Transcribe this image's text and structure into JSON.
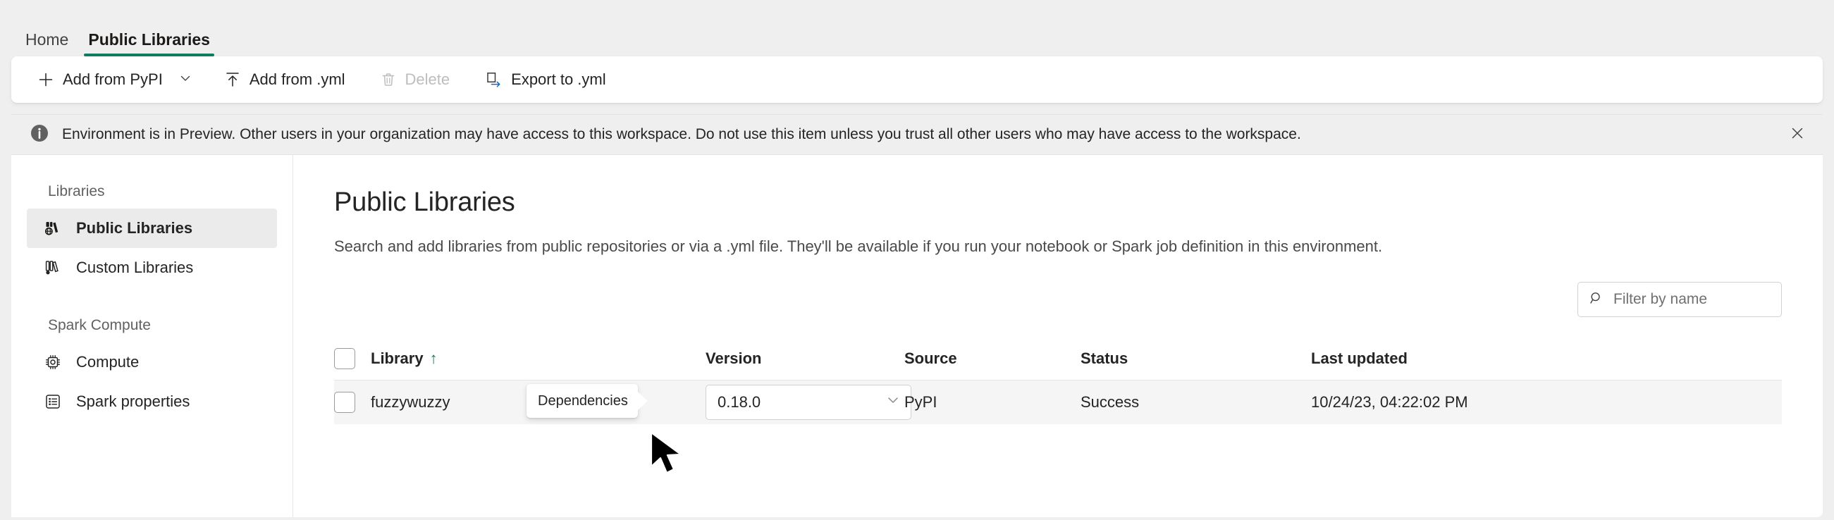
{
  "tabs": [
    {
      "label": "Home",
      "active": false
    },
    {
      "label": "Public Libraries",
      "active": true
    }
  ],
  "toolbar": {
    "add_from_pypi": "Add from PyPI",
    "add_from_yml": "Add from .yml",
    "delete": "Delete",
    "export_to_yml": "Export to .yml",
    "chevron_icon": "chevron-down-icon",
    "plus_icon": "plus-icon",
    "upload_icon": "upload-arrow-icon",
    "trash_icon": "trash-icon",
    "export_icon": "export-page-icon"
  },
  "notification": {
    "icon": "info-icon",
    "message": "Environment is in Preview. Other users in your organization may have access to this workspace. Do not use this item unless you trust all other users who may have access to the workspace.",
    "close_icon": "close-icon"
  },
  "sidebar": {
    "groups": [
      {
        "title": "Libraries",
        "items": [
          {
            "label": "Public Libraries",
            "icon": "public-libraries-icon",
            "selected": true
          },
          {
            "label": "Custom Libraries",
            "icon": "custom-libraries-icon",
            "selected": false
          }
        ]
      },
      {
        "title": "Spark Compute",
        "items": [
          {
            "label": "Compute",
            "icon": "chip-icon",
            "selected": false
          },
          {
            "label": "Spark properties",
            "icon": "list-properties-icon",
            "selected": false
          }
        ]
      }
    ]
  },
  "main": {
    "title": "Public Libraries",
    "description": "Search and add libraries from public repositories or via a .yml file. They'll be available if you run your notebook or Spark job definition in this environment.",
    "filter": {
      "placeholder": "Filter by name",
      "value": "",
      "icon": "search-icon"
    },
    "table": {
      "columns": [
        {
          "key": "library",
          "label": "Library",
          "sort": "ascending",
          "sort_glyph": "↑"
        },
        {
          "key": "version",
          "label": "Version"
        },
        {
          "key": "source",
          "label": "Source"
        },
        {
          "key": "status",
          "label": "Status"
        },
        {
          "key": "last_updated",
          "label": "Last updated"
        }
      ],
      "rows": [
        {
          "selected": false,
          "library": "fuzzywuzzy",
          "version": "0.18.0",
          "source": "PyPI",
          "status": "Success",
          "last_updated": "10/24/23, 04:22:02 PM",
          "actions": {
            "dependencies_icon": "dependencies-hierarchy-icon",
            "delete_icon": "trash-icon"
          }
        }
      ]
    },
    "tooltip": {
      "text": "Dependencies",
      "target": "dependencies-button"
    }
  },
  "colors": {
    "accent_teal": "#107c5f",
    "row_hover": "#f5f5f5",
    "page_bg": "#efefef",
    "text_primary": "#242424",
    "text_secondary": "#616161"
  },
  "cursor": {
    "icon": "mouse-pointer-arrow"
  }
}
